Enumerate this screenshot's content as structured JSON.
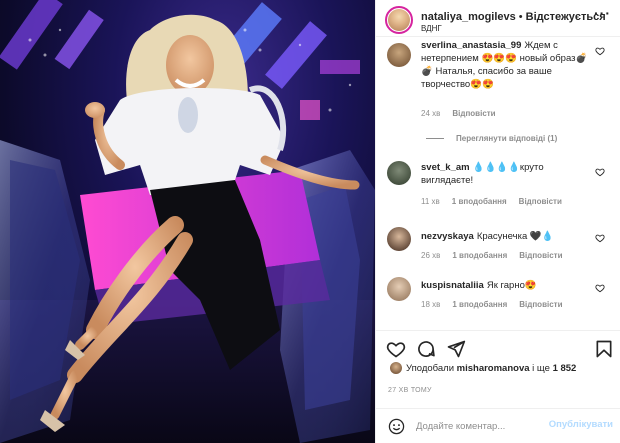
{
  "photo": {
    "description_icon": "photo-image"
  },
  "header": {
    "username": "nataliya_mogilevs",
    "separator": "•",
    "follow_label": "Відстежується",
    "location": "ВДНГ"
  },
  "comments": [
    {
      "username": "sverlina_anastasia_99",
      "text": "Ждем с нетерпением 😍😍😍 новый образ💣💣 Наталья, спасибо за ваше творчество😍😍",
      "age": "24 хв",
      "likes": "",
      "reply": "Відповісти",
      "view_replies": "Переглянути відповіді (1)"
    },
    {
      "username": "svet_k_am",
      "text": "💧💧💧💧крутo виглядаєте!",
      "age": "11 хв",
      "likes": "1 вподобання",
      "reply": "Відповісти"
    },
    {
      "username": "nezvyskaya",
      "text": "Красунечка 🖤💧",
      "age": "26 хв",
      "likes": "1 вподобання",
      "reply": "Відповісти"
    },
    {
      "username": "kuspisnataliia",
      "text": "Як гарно😍",
      "age": "18 хв",
      "likes": "1 вподобання",
      "reply": "Відповісти"
    }
  ],
  "likes_line": {
    "prefix": "Уподобали",
    "user": "misharomanova",
    "suffix": "і ще",
    "count": "1 852"
  },
  "timestamp": "27 ХВ ТОМУ",
  "composer": {
    "placeholder": "Додайте коментар...",
    "post_label": "Опублікувати"
  },
  "colors": {
    "text": "#262626",
    "muted": "#8e8e8e",
    "post_disabled": "#b3dbff",
    "story_ring": "#d6249f"
  }
}
